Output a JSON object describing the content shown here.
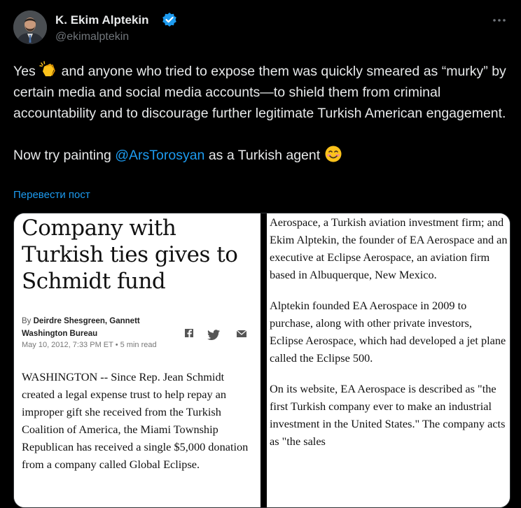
{
  "author": {
    "name": "K. Ekim Alptekin",
    "handle": "@ekimalptekin"
  },
  "icons": {
    "verified": "verified-badge-icon",
    "more": "more-options-icon",
    "clap": "clapping-hands-emoji",
    "smile": "smiling-face-emoji"
  },
  "colors": {
    "background": "#000000",
    "text": "#e7e9ea",
    "muted": "#71767b",
    "link": "#1d9bf0"
  },
  "tweet": {
    "line1_start": "Yes ",
    "line1_rest": " and anyone who tried to expose them was quickly smeared as “murky” by certain media and social media accounts—to shield them from criminal accountability and to discourage further legitimate Turkish American engagement.",
    "line2_start": "Now try painting ",
    "mention": "@ArsTorosyan",
    "line2_end": " as a Turkish agent "
  },
  "translate_label": "Перевести пост",
  "article": {
    "headline": "Company with Turkish ties gives to Schmidt fund",
    "byline_prefix": "By ",
    "byline_author": "Deirdre Shesgreen, Gannett",
    "byline_bureau": "Washington Bureau",
    "date": "May 10, 2012, 7:33 PM ET • 5 min read",
    "body_left": "WASHINGTON -- Since Rep. Jean Schmidt created a legal expense trust to help repay an improper gift she received from the Turkish Coalition of America, the Miami Township Republican has received a single $5,000 donation from a company called Global Eclipse.",
    "right_p1": "Aerospace, a Turkish aviation investment firm; and Ekim Alptekin, the founder of EA Aerospace and an executive at Eclipse Aerospace, an aviation firm based in Albuquerque, New Mexico.",
    "right_p2": "Alptekin founded EA Aerospace in 2009 to purchase, along with other private investors, Eclipse Aerospace, which had developed a jet plane called the Eclipse 500.",
    "right_p3": "On its website, EA Aerospace is described as \"the first Turkish company ever to make an industrial investment in the United States.\" The company acts as \"the sales"
  }
}
